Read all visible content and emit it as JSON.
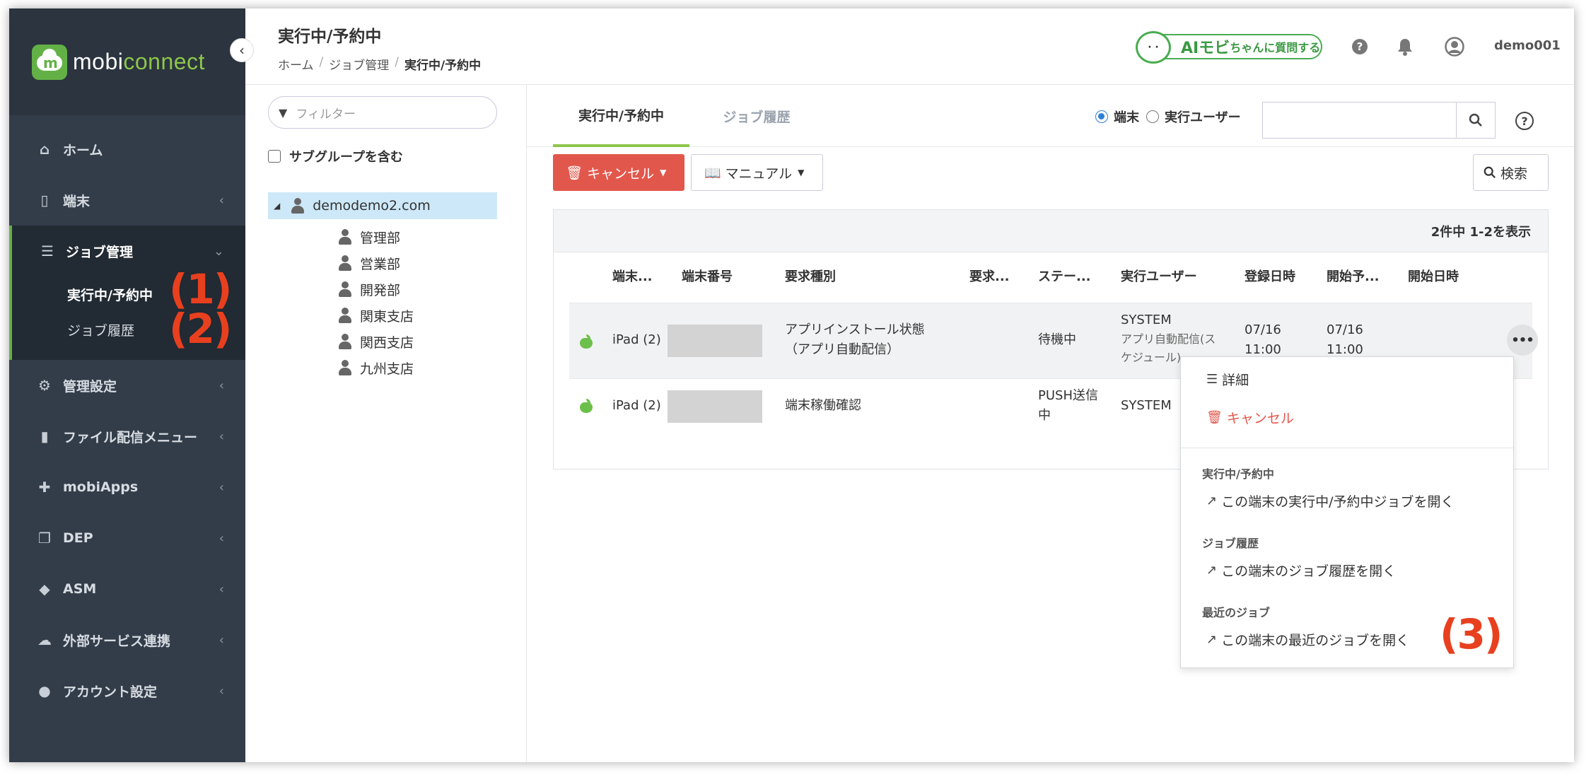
{
  "sidebar": {
    "logo_a": "mobi",
    "logo_b": "connect",
    "items": [
      {
        "label": "ホーム",
        "icon": "home-icon"
      },
      {
        "label": "端末",
        "icon": "device-icon"
      },
      {
        "label": "ジョブ管理",
        "icon": "job-icon"
      },
      {
        "label": "管理設定",
        "icon": "gears-icon"
      },
      {
        "label": "ファイル配信メニュー",
        "icon": "file-icon"
      },
      {
        "label": "mobiApps",
        "icon": "puzzle-icon"
      },
      {
        "label": "DEP",
        "icon": "copy-icon"
      },
      {
        "label": "ASM",
        "icon": "graduation-cap-icon"
      },
      {
        "label": "外部サービス連携",
        "icon": "cloud-icon"
      },
      {
        "label": "アカウント設定",
        "icon": "users-icon"
      }
    ],
    "sub_items": [
      {
        "label": "実行中/予約中"
      },
      {
        "label": "ジョブ履歴"
      }
    ],
    "markers": [
      "(1)",
      "(2)"
    ]
  },
  "header": {
    "title": "実行中/予約中",
    "breadcrumb": [
      "ホーム",
      "ジョブ管理",
      "実行中/予約中"
    ],
    "breadcrumb_sep": "/",
    "ai_button_big": "AIモビ",
    "ai_button_small": "ちゃんに質問する",
    "user": "demo001"
  },
  "tree": {
    "filter_placeholder": "フィルター",
    "include_subgroups": "サブグループを含む",
    "root": "demodemo2.com",
    "children": [
      "管理部",
      "営業部",
      "開発部",
      "関東支店",
      "関西支店",
      "九州支店"
    ]
  },
  "tabs": {
    "active": "実行中/予約中",
    "inactive": "ジョブ履歴"
  },
  "search": {
    "radio_device": "端末",
    "radio_user": "実行ユーザー",
    "selected": "端末",
    "value": ""
  },
  "toolbar": {
    "cancel": "キャンセル",
    "manual": "マニュアル",
    "search": "検索"
  },
  "table": {
    "count": "2件中 1-2を表示",
    "headers": [
      "端末...",
      "端末番号",
      "要求種別",
      "要求...",
      "ステー...",
      "実行ユーザー",
      "登録日時",
      "開始予...",
      "開始日時"
    ],
    "rows": [
      {
        "device": "iPad (2)",
        "type_line1": "アプリインストール状態",
        "type_line2": "（アプリ自動配信）",
        "status": "待機中",
        "user": "SYSTEM",
        "user_sub_line1": "アプリ自動配信(ス",
        "user_sub_line2": "ケジュール)",
        "registered_line1": "07/16",
        "registered_line2": "11:00",
        "scheduled_line1": "07/16",
        "scheduled_line2": "11:00"
      },
      {
        "device": "iPad (2)",
        "type_line1": "端末稼働確認",
        "status_line1": "PUSH送信",
        "status_line2": "中",
        "user": "SYSTEM"
      }
    ]
  },
  "dropdown": {
    "detail": "詳細",
    "cancel": "キャンセル",
    "section1": "実行中/予約中",
    "link1": "この端末の実行中/予約中ジョブを開く",
    "section2": "ジョブ履歴",
    "link2": "この端末のジョブ履歴を開く",
    "section3": "最近のジョブ",
    "link3": "この端末の最近のジョブを開く",
    "marker": "(3)"
  },
  "colors": {
    "sidebar_bg": "#333d4a",
    "accent_green": "#8dc64a",
    "danger": "#e2574c",
    "marker_red": "#e8401f"
  }
}
